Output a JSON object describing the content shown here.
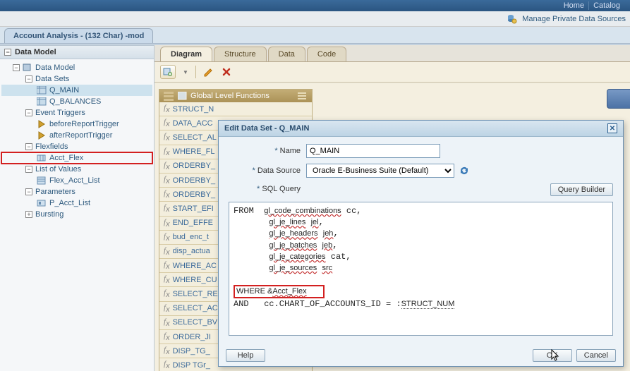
{
  "header": {
    "links": [
      "Home",
      "Catalog"
    ],
    "manage_link": "Manage Private Data Sources"
  },
  "doc_tab": "Account Analysis - (132 Char) -mod",
  "sidebar": {
    "title": "Data Model",
    "root": "Data Model",
    "sections": [
      {
        "label": "Data Sets",
        "items": [
          "Q_MAIN",
          "Q_BALANCES"
        ]
      },
      {
        "label": "Event Triggers",
        "items": [
          "beforeReportTrigger",
          "afterReportTrigger"
        ]
      },
      {
        "label": "Flexfields",
        "items": [
          "Acct_Flex"
        ]
      },
      {
        "label": "List of Values",
        "items": [
          "Flex_Acct_List"
        ]
      },
      {
        "label": "Parameters",
        "items": [
          "P_Acct_List"
        ]
      },
      {
        "label": "Bursting",
        "items": []
      }
    ]
  },
  "tabs2": [
    "Diagram",
    "Structure",
    "Data",
    "Code"
  ],
  "func_panel": {
    "title": "Global Level Functions",
    "items": [
      "STRUCT_N",
      "DATA_ACC",
      "SELECT_AL",
      "WHERE_FL",
      "ORDERBY_",
      "ORDERBY_",
      "ORDERBY_",
      "START_EFI",
      "END_EFFE",
      "bud_enc_t",
      "disp_actua",
      "WHERE_AC",
      "WHERE_CU",
      "SELECT_RE",
      "SELECT_AC",
      "SELECT_BV",
      "ORDER_JI",
      "DISP_TG_",
      "DISP TGr_"
    ]
  },
  "dialog": {
    "title": "Edit Data Set - Q_MAIN",
    "name_label": "Name",
    "name_value": "Q_MAIN",
    "ds_label": "Data Source",
    "ds_value": "Oracle E-Business Suite (Default)",
    "sql_label": "SQL Query",
    "qb_label": "Query Builder",
    "sql_lines": [
      "FROM  gl_code_combinations cc,",
      "       gl_je_lines jel,",
      "       gl_je_headers jeh,",
      "       gl_je_batches jeb,",
      "       gl_je_categories cat,",
      "       gl_je_sources src",
      "",
      "WHERE &Acct_Flex",
      "AND   cc.CHART_OF_ACCOUNTS_ID = :STRUCT_NUM"
    ],
    "help": "Help",
    "ok": "OK",
    "cancel": "Cancel"
  }
}
